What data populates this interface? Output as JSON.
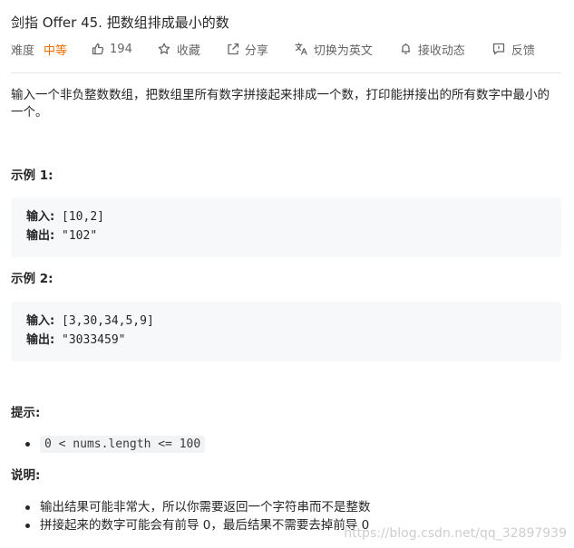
{
  "problem": {
    "title": "剑指 Offer 45. 把数组排成最小的数",
    "difficulty_label": "难度",
    "difficulty": "中等",
    "likes": "194",
    "favorite": "收藏",
    "share": "分享",
    "switch_en": "切换为英文",
    "subscribe": "接收动态",
    "feedback": "反馈"
  },
  "content": {
    "description": "输入一个非负整数数组，把数组里所有数字拼接起来排成一个数，打印能拼接出的所有数字中最小的一个。",
    "example1": {
      "title": "示例 1:",
      "input_label": "输入:",
      "input": "[10,2]",
      "output_label": "输出:",
      "output": "\"102\""
    },
    "example2": {
      "title": "示例 2:",
      "input_label": "输入:",
      "input": "[3,30,34,5,9]",
      "output_label": "输出:",
      "output": "\"3033459\""
    },
    "hint_title": "提示:",
    "hint": "0 < nums.length <= 100",
    "note_title": "说明:",
    "notes": [
      "输出结果可能非常大，所以你需要返回一个字符串而不是整数",
      "拼接起来的数字可能会有前导 0，最后结果不需要去掉前导 0"
    ]
  },
  "watermark": "https://blog.csdn.net/qq_32897939",
  "colors": {
    "difficulty": "#ef6c00",
    "text": "#262626",
    "muted": "#666666",
    "code_bg": "#f7f8fa"
  }
}
